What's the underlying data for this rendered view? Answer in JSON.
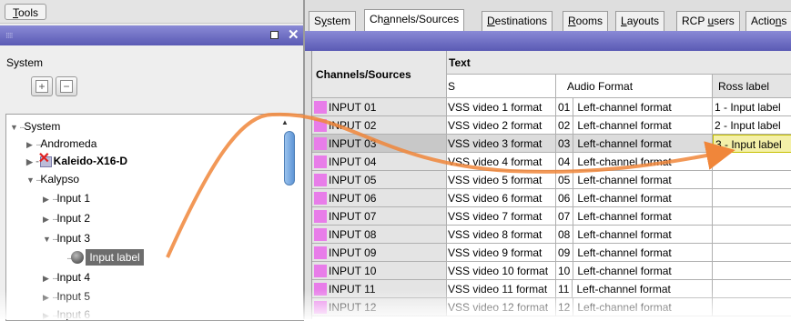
{
  "left_panel": {
    "tools_button": {
      "prefix": "",
      "underlined": "T",
      "rest": "ools"
    },
    "system_label": "System",
    "plus_icon": "+",
    "minus_icon": "−",
    "tree": [
      {
        "label": "System",
        "toggle": "▼",
        "indent": 0
      },
      {
        "label": "Andromeda",
        "toggle": "▶",
        "indent": 1
      },
      {
        "label": "Kaleido-X16-D",
        "toggle": "▶",
        "indent": 1,
        "bold": true
      },
      {
        "label": "Kalypso",
        "toggle": "▼",
        "indent": 1
      },
      {
        "label": "Input 1",
        "toggle": "▶",
        "indent": 2
      },
      {
        "label": "Input 2",
        "toggle": "▶",
        "indent": 2
      },
      {
        "label": "Input 3",
        "toggle": "▼",
        "indent": 2
      },
      {
        "label": "Input label",
        "toggle": "",
        "indent": 3,
        "selected": true
      },
      {
        "label": "Input 4",
        "toggle": "▶",
        "indent": 2
      },
      {
        "label": "Input 5",
        "toggle": "▶",
        "indent": 2
      },
      {
        "label": "Input 6",
        "toggle": "▶",
        "indent": 2
      }
    ]
  },
  "right_panel": {
    "tabs": [
      {
        "pre": "S",
        "u": "y",
        "post": "stem"
      },
      {
        "pre": "Ch",
        "u": "a",
        "post": "nnels/Sources",
        "active": true
      },
      {
        "pre": "",
        "u": "D",
        "post": "estinations"
      },
      {
        "pre": "",
        "u": "R",
        "post": "ooms"
      },
      {
        "pre": "",
        "u": "L",
        "post": "ayouts"
      },
      {
        "pre": "RCP ",
        "u": "u",
        "post": "sers"
      },
      {
        "pre": "Actio",
        "u": "n",
        "post": "s"
      }
    ],
    "grid": {
      "header_channels": "Channels/Sources",
      "header_text": "Text",
      "sub_s": "S",
      "sub_audio": "Audio Format",
      "sub_ross": "Ross label",
      "swatch_color": "#e87de9",
      "rows": [
        {
          "source": "INPUT 01",
          "s": "VSS video 1 format",
          "num": "01",
          "audio": "Left-channel format",
          "ross": "1 - Input label"
        },
        {
          "source": "INPUT 02",
          "s": "VSS video 2 format",
          "num": "02",
          "audio": "Left-channel format",
          "ross": "2 - Input label"
        },
        {
          "source": "INPUT 03",
          "s": "VSS video 3 format",
          "num": "03",
          "audio": "Left-channel format",
          "ross": "3 - Input label",
          "selected": true
        },
        {
          "source": "INPUT 04",
          "s": "VSS video 4 format",
          "num": "04",
          "audio": "Left-channel format",
          "ross": ""
        },
        {
          "source": "INPUT 05",
          "s": "VSS video 5 format",
          "num": "05",
          "audio": "Left-channel format",
          "ross": ""
        },
        {
          "source": "INPUT 06",
          "s": "VSS video 6 format",
          "num": "06",
          "audio": "Left-channel format",
          "ross": ""
        },
        {
          "source": "INPUT 07",
          "s": "VSS video 7 format",
          "num": "07",
          "audio": "Left-channel format",
          "ross": ""
        },
        {
          "source": "INPUT 08",
          "s": "VSS video 8 format",
          "num": "08",
          "audio": "Left-channel format",
          "ross": ""
        },
        {
          "source": "INPUT 09",
          "s": "VSS video 9 format",
          "num": "09",
          "audio": "Left-channel format",
          "ross": ""
        },
        {
          "source": "INPUT 10",
          "s": "VSS video 10 format",
          "num": "10",
          "audio": "Left-channel format",
          "ross": ""
        },
        {
          "source": "INPUT 11",
          "s": "VSS video 11 format",
          "num": "11",
          "audio": "Left-channel format",
          "ross": ""
        },
        {
          "source": "INPUT 12",
          "s": "VSS video 12 format",
          "num": "12",
          "audio": "Left-channel format",
          "ross": ""
        }
      ]
    }
  },
  "colors": {
    "accent_arrow": "#f0863a",
    "titlebar": "#6a6ac4",
    "selection_ross": "#f4f0a8"
  }
}
